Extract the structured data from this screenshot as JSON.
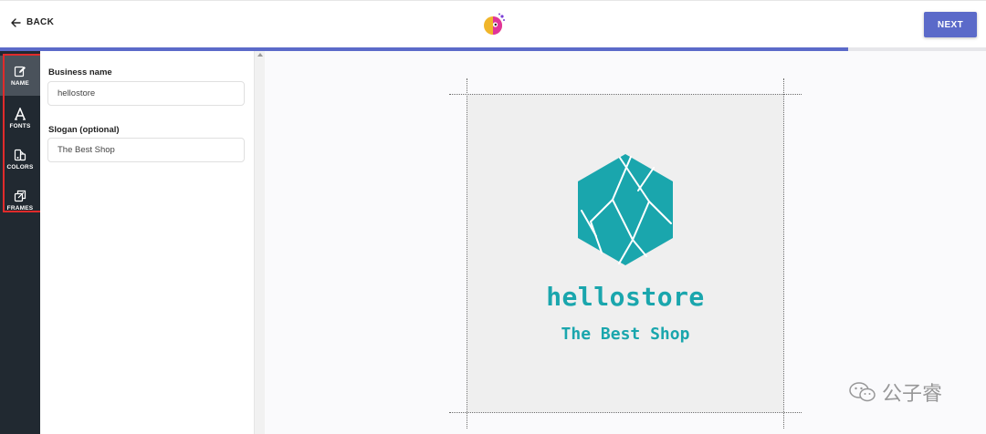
{
  "header": {
    "back_label": "BACK",
    "next_label": "NEXT"
  },
  "progress": {
    "percent": 86
  },
  "rail": {
    "items": [
      {
        "label": "NAME",
        "icon": "edit-icon",
        "active": true
      },
      {
        "label": "FONTS",
        "icon": "font-icon",
        "active": false
      },
      {
        "label": "COLORS",
        "icon": "palette-icon",
        "active": false
      },
      {
        "label": "FRAMES",
        "icon": "frames-icon",
        "active": false
      }
    ]
  },
  "form": {
    "business_name_label": "Business name",
    "business_name_value": "hellostore",
    "slogan_label": "Slogan (optional)",
    "slogan_value": "The Best Shop"
  },
  "preview": {
    "brand_name": "hellostore",
    "slogan": "The Best Shop"
  },
  "watermark": {
    "text": "公子睿",
    "icon": "wechat-icon"
  },
  "colors": {
    "accent": "#5b6ac9",
    "rail_bg": "#212931",
    "rail_active": "#4a525b",
    "brand_teal": "#1aa6ad",
    "highlight_red": "#e02b2b"
  }
}
